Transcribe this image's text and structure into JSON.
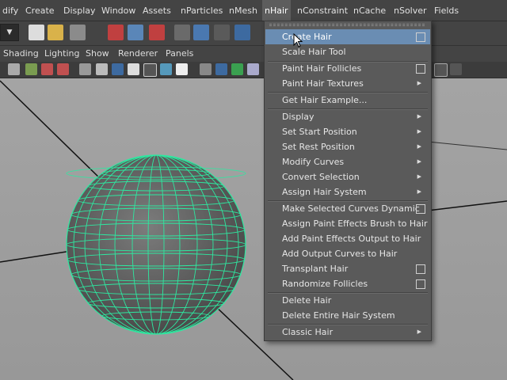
{
  "menubar": {
    "items": [
      "dify",
      "Create",
      "Display",
      "Window",
      "Assets",
      "nParticles",
      "nMesh",
      "nHair",
      "nConstraint",
      "nCache",
      "nSolver",
      "Fields"
    ]
  },
  "panel_menu": {
    "items": [
      "Shading",
      "Lighting",
      "Show",
      "Renderer",
      "Panels"
    ]
  },
  "nhair_menu": {
    "items": [
      {
        "label": "Create Hair",
        "option_box": true,
        "highlighted": true
      },
      {
        "label": "Scale Hair Tool"
      },
      {
        "label": "Paint Hair Follicles",
        "option_box": true
      },
      {
        "label": "Paint Hair Textures",
        "submenu": true
      },
      {
        "label": "Get Hair Example..."
      },
      {
        "label": "Display",
        "submenu": true
      },
      {
        "label": "Set Start Position",
        "submenu": true
      },
      {
        "label": "Set Rest Position",
        "submenu": true
      },
      {
        "label": "Modify Curves",
        "submenu": true
      },
      {
        "label": "Convert Selection",
        "submenu": true
      },
      {
        "label": "Assign Hair System",
        "submenu": true
      },
      {
        "label": "Make Selected Curves Dynamic",
        "option_box": true
      },
      {
        "label": "Assign Paint Effects Brush to Hair"
      },
      {
        "label": "Add Paint Effects Output to Hair"
      },
      {
        "label": "Add Output Curves to Hair"
      },
      {
        "label": "Transplant Hair",
        "option_box": true
      },
      {
        "label": "Randomize Follicles",
        "option_box": true
      },
      {
        "label": "Delete Hair"
      },
      {
        "label": "Delete Entire Hair System"
      },
      {
        "label": "Classic Hair",
        "submenu": true
      }
    ]
  },
  "colors": {
    "wireframe": "#2ee8a0",
    "highlight": "#6a8db3",
    "viewport": "#a0a0a0"
  }
}
